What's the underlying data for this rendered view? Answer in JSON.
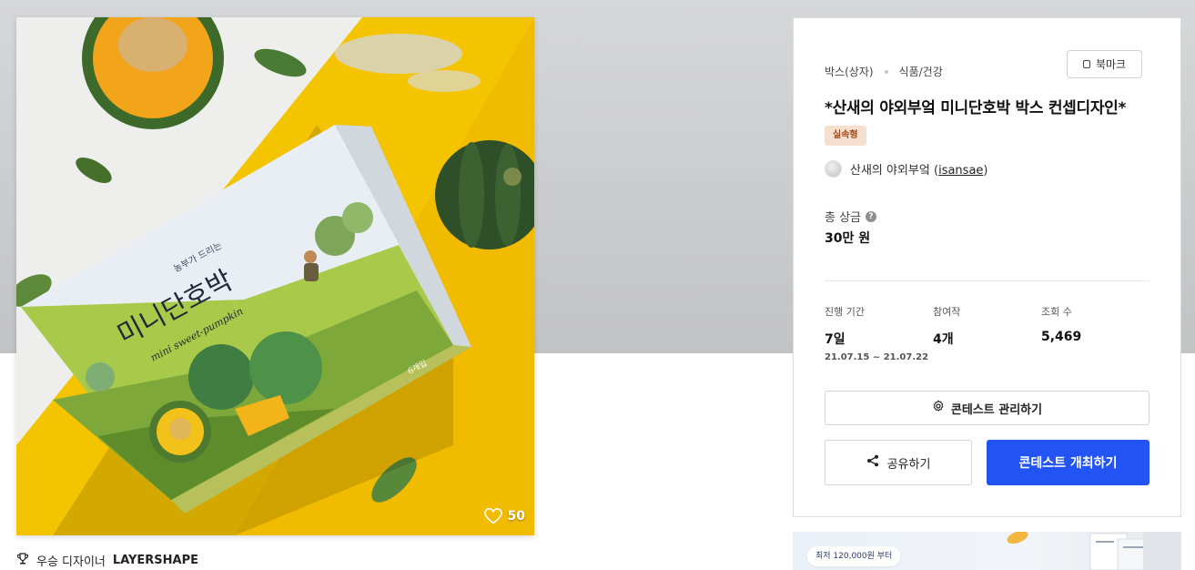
{
  "artwork": {
    "likes": "50",
    "box_caption": "농부가 드리는",
    "box_title": "미니단호박",
    "box_script": "mini sweet-pumpkin",
    "box_count": "6개입"
  },
  "designer": {
    "label": "우승 디자이너",
    "name": "LAYERSHAPE"
  },
  "contest": {
    "category": "박스(상자)",
    "subcategory": "식품/건강",
    "bookmark_label": "북마크",
    "title": "*산새의 야외부엌 미니단호박 박스 컨셉디자인*",
    "type_badge": "실속형",
    "owner_name": "산새의 야외부엌",
    "owner_handle": "isansae",
    "prize_label": "총 상금",
    "prize_value": "30만 원",
    "stats": {
      "period_label": "진행 기간",
      "period_value": "7일",
      "period_range": "21.07.15 ~ 21.07.22",
      "entries_label": "참여작",
      "entries_value": "4개",
      "views_label": "조회 수",
      "views_value": "5,469"
    },
    "manage_label": "콘테스트 관리하기",
    "share_label": "공유하기",
    "host_label": "콘테스트 개최하기"
  },
  "promo": {
    "pill_text": "최저 120,000원 부터"
  },
  "colors": {
    "primary": "#2254f4",
    "badge_bg": "#f7dfcf",
    "badge_text": "#a44d1a",
    "hero_bg": "#c8c9cb",
    "yellow": "#f5c400"
  },
  "icons": [
    "bookmark-icon",
    "info-icon",
    "gear-icon",
    "share-icon",
    "heart-icon",
    "trophy-icon"
  ]
}
